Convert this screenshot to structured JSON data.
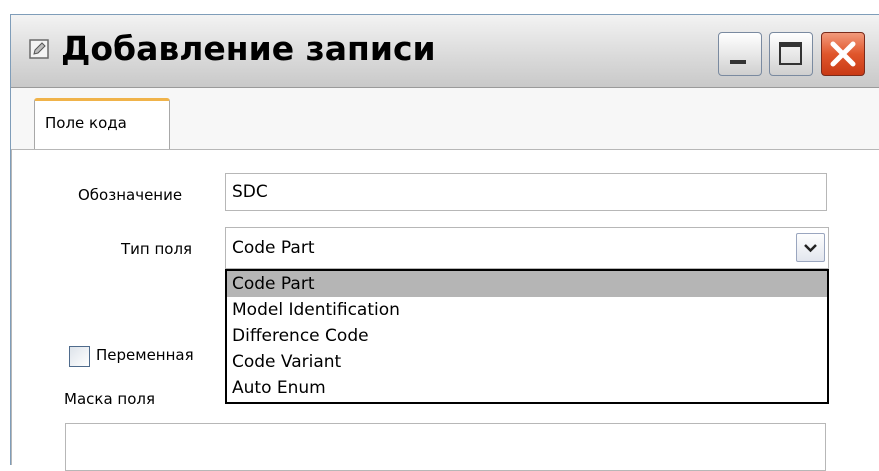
{
  "window": {
    "title": "Добавление записи",
    "icons": {
      "app": "pencil-icon",
      "minimize": "minimize-icon",
      "maximize": "maximize-icon",
      "close": "close-icon"
    }
  },
  "tabs": [
    {
      "label": "Поле кода",
      "selected": true
    }
  ],
  "form": {
    "designation_label": "Обозначение",
    "designation_value": "SDC",
    "field_type_label": "Тип поля",
    "field_type_value": "Code Part",
    "field_type_options": [
      "Code Part",
      "Model Identification",
      "Difference Code",
      "Code Variant",
      "Auto Enum"
    ],
    "variable_label": "Переменная",
    "variable_checked": false,
    "mask_label": "Маска поля",
    "mask_value": ""
  },
  "colors": {
    "tab_accent": "#f0b34a",
    "close_button": "#e0562c",
    "selected_option": "#b5b5b5"
  }
}
